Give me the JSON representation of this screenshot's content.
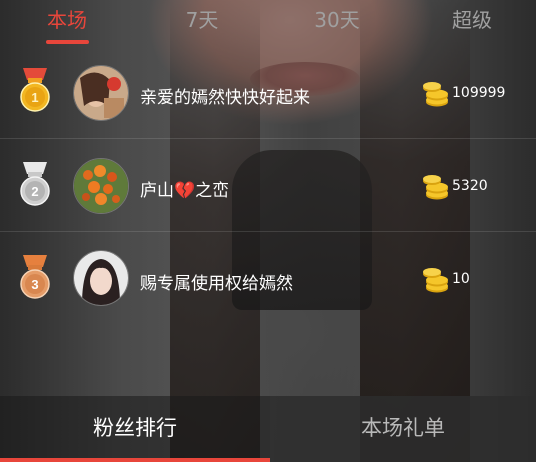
{
  "tabs": [
    {
      "label": "本场",
      "active": true
    },
    {
      "label": "7天",
      "active": false
    },
    {
      "label": "30天",
      "active": false
    },
    {
      "label": "超级",
      "active": false
    }
  ],
  "ranking": [
    {
      "rank": "1",
      "medal": "gold-medal-icon",
      "name": "亲爱的嫣然快快好起来",
      "amount": "109999"
    },
    {
      "rank": "2",
      "medal": "silver-medal-icon",
      "name_before": "庐山",
      "name_emoji": "💔",
      "name_after": "之峦",
      "amount": "5320"
    },
    {
      "rank": "3",
      "medal": "bronze-medal-icon",
      "name": "赐专属使用权给嫣然",
      "amount": "10"
    }
  ],
  "bottom_tabs": [
    {
      "label": "粉丝排行",
      "active": true
    },
    {
      "label": "本场礼单",
      "active": false
    }
  ],
  "colors": {
    "accent": "#e8463b",
    "coin": "#f2c21a"
  }
}
